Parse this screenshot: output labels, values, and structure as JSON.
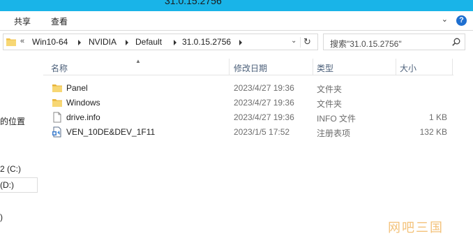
{
  "window": {
    "title": "31.0.15.2756"
  },
  "ribbon": {
    "tabs": [
      "共享",
      "查看"
    ],
    "expand_glyph": "⌄",
    "help_glyph": "?"
  },
  "address": {
    "overflow_glyph": "«",
    "crumbs": [
      "Win10-64",
      "NVIDIA",
      "Default",
      "31.0.15.2756"
    ],
    "dropdown_glyph": "⌄",
    "refresh_glyph": "↻"
  },
  "search": {
    "placeholder": "搜索\"31.0.15.2756\""
  },
  "nav": {
    "items": [
      "的位置",
      "2 (C:)",
      "(D:)",
      ")"
    ]
  },
  "columns": {
    "name": "名称",
    "date": "修改日期",
    "type": "类型",
    "size": "大小"
  },
  "files": [
    {
      "name": "Panel",
      "date": "2023/4/27 19:36",
      "type": "文件夹",
      "size": "",
      "icon": "folder-icon"
    },
    {
      "name": "Windows",
      "date": "2023/4/27 19:36",
      "type": "文件夹",
      "size": "",
      "icon": "folder-icon"
    },
    {
      "name": "drive.info",
      "date": "2023/4/27 19:36",
      "type": "INFO 文件",
      "size": "1 KB",
      "icon": "file-icon"
    },
    {
      "name": "VEN_10DE&DEV_1F11",
      "date": "2023/1/5 17:52",
      "type": "注册表项",
      "size": "132 KB",
      "icon": "registry-file-icon"
    }
  ],
  "watermark": {
    "text": "网吧三国"
  },
  "colors": {
    "titlebar": "#19b4e8",
    "folder": "#f0c24b",
    "header_text": "#4c607a"
  }
}
